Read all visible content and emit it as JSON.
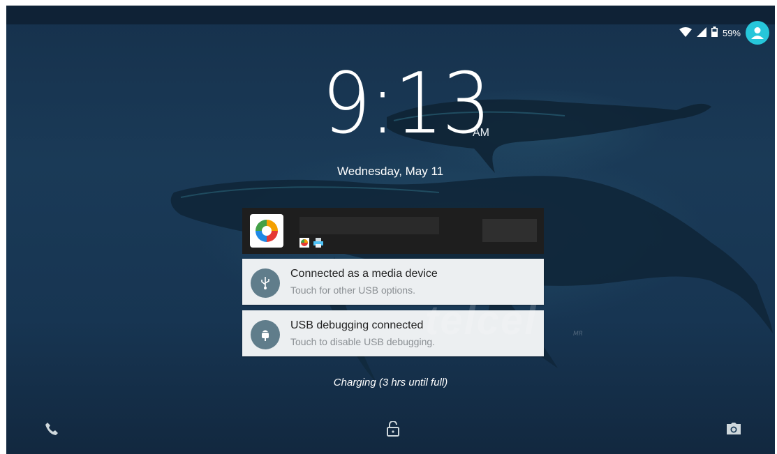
{
  "status_bar": {
    "battery_percent": "59%",
    "icons": [
      "wifi-icon",
      "cell-signal-icon",
      "battery-icon",
      "user-avatar-icon"
    ]
  },
  "lock_screen": {
    "time": "9:13",
    "ampm": "AM",
    "date": "Wednesday, May 11",
    "charging": "Charging (3 hrs until full)",
    "watermark": "telcel",
    "watermark_mark": "MR"
  },
  "notifications": {
    "usb_media": {
      "title": "Connected as a media device",
      "subtitle": "Touch for other USB options.",
      "icon": "usb-icon"
    },
    "usb_debug": {
      "title": "USB debugging connected",
      "subtitle": "Touch to disable USB debugging.",
      "icon": "android-debug-icon"
    }
  },
  "bottom_bar": {
    "icons": [
      "phone-icon",
      "unlock-icon",
      "camera-icon"
    ]
  },
  "colors": {
    "avatar": "#26c6da",
    "notification_card": "#eceff1",
    "notification_icon_bg": "#607d8b",
    "wallpaper": "#1a3a57"
  }
}
